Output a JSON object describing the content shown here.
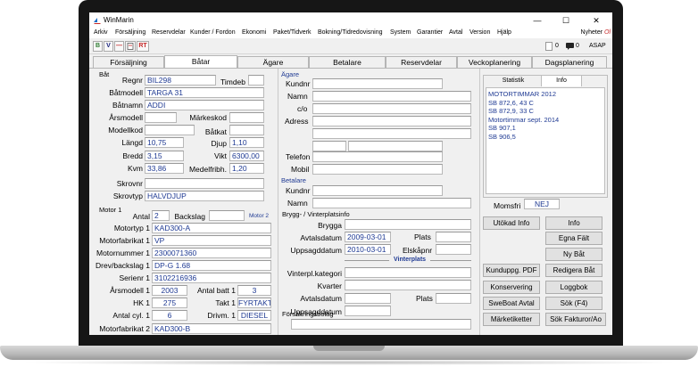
{
  "window": {
    "title": "WinMarin",
    "minimize": "—",
    "maximize": "☐",
    "close": "✕"
  },
  "menu": {
    "items": [
      "Arkiv",
      "Försäljning",
      "Reservdelar",
      "Kunder / Fordon",
      "Ekonomi",
      "Paket/Tidverk",
      "Bokning/Tidredovisning",
      "System",
      "Garantier",
      "Avtal",
      "Version",
      "Hjälp"
    ],
    "news_label": "Nyheter",
    "news_suffix": "Ol"
  },
  "toolbar": {
    "buttons": [
      "B",
      "V",
      "—",
      "",
      ""
    ],
    "rt_label": "RT",
    "counter1": "0",
    "counter2": "0",
    "asap_label": "ASAP"
  },
  "tabs": [
    "Försäljning",
    "Båtar",
    "Ägare",
    "Betalare",
    "Reservdelar",
    "Veckoplanering",
    "Dagsplanering"
  ],
  "bat": {
    "group": "Båt",
    "regnr_label": "Regnr",
    "regnr": "BIL298",
    "timdeb_label": "Timdeb",
    "timdeb": "",
    "batmodell_label": "Båtmodell",
    "batmodell": "TARGA 31",
    "batnamn_label": "Båtnamn",
    "batnamn": "ADDI",
    "arsmodell_label": "Årsmodell",
    "arsmodell": "",
    "markeskod_label": "Märkeskod",
    "markeskod": "",
    "modellkod_label": "Modellkod",
    "modellkod": "",
    "batkat_label": "Båtkat",
    "batkat": "",
    "langd_label": "Längd",
    "langd": "10,75",
    "djup_label": "Djup",
    "djup": "1,10",
    "bredd_label": "Bredd",
    "bredd": "3,15",
    "vikt_label": "Vikt",
    "vikt": "6300,00",
    "kvm_label": "Kvm",
    "kvm": "33,86",
    "medelfribh_label": "Medelfribh.",
    "medelfribh": "1,20",
    "skrovnr_label": "Skrovnr",
    "skrovnr": "",
    "skrovtyp_label": "Skrovtyp",
    "skrovtyp": "HALVDJUP"
  },
  "motor": {
    "group": "Motor 1",
    "antal_label": "Antal",
    "antal": "2",
    "backslag_label": "Backslag",
    "backslag": "",
    "motor2_label": "Motor 2",
    "motortyp_label": "Motortyp 1",
    "motortyp": "KAD300-A",
    "motorfabrikat_label": "Motorfabrikat 1",
    "motorfabrikat": "VP",
    "motornummer_label": "Motornummer 1",
    "motornummer": "2300071360",
    "drev_label": "Drev/backslag 1",
    "drev": "DP-G 1.68",
    "serienr_label": "Serienr 1",
    "serienr": "3102216936",
    "arsmodell_label": "Årsmodell 1",
    "arsmodell": "2003",
    "antal_batt_label": "Antal batt 1",
    "antal_batt": "3",
    "hk_label": "HK 1",
    "hk": "275",
    "takt_label": "Takt 1",
    "takt": "FYRTAKT",
    "antal_cyl_label": "Antal cyl. 1",
    "antal_cyl": "6",
    "drivm_label": "Drivm. 1",
    "drivm": "DIESEL",
    "bottom_label": "Motorfabrikat 2",
    "bottom_value": "KAD300-B"
  },
  "agare": {
    "group": "Ägare",
    "kundnr_label": "Kundnr",
    "kundnr": "",
    "namn_label": "Namn",
    "namn": "",
    "co_label": "c/o",
    "co": "",
    "adress_label": "Adress",
    "adress": "",
    "telefon_label": "Telefon",
    "telefon": "",
    "mobil_label": "Mobil",
    "mobil": ""
  },
  "betalare": {
    "group": "Betalare",
    "kundnr_label": "Kundnr",
    "kundnr": "",
    "namn_label": "Namn",
    "namn": ""
  },
  "brygg": {
    "group": "Brygg- / Vinterplatsinfo",
    "brygga_label": "Brygga",
    "brygga": "",
    "avtalsdatum_label": "Avtalsdatum",
    "avtalsdatum": "2009-03-01",
    "plats_label": "Plats",
    "plats": "",
    "uppsagddatum_label": "Uppsagddatum",
    "uppsagddatum": "2010-03-01",
    "elskapnr_label": "Elskåpnr",
    "elskapnr": "",
    "vinterplats_label": "Vinterplats",
    "vinterplats_kategori_label": "Vinterpl.kategori",
    "vinterplats_kategori": "",
    "kvarter_label": "Kvarter",
    "kvarter": "",
    "v_avtalsdatum_label": "Avtalsdatum",
    "v_avtalsdatum": "",
    "v_plats_label": "Plats",
    "v_plats": "",
    "v_uppsagddatum_label": "Uppsagddatum",
    "v_uppsagddatum": "",
    "forsakring_label": "Försäkringsbolag",
    "forsakring": ""
  },
  "info": {
    "tab_statistik": "Statistik",
    "tab_info": "Info",
    "lines": [
      "MOTORTIMMAR 2012",
      "SB 872,6, 43 C",
      "SB 872,9, 33 C",
      "Motortimmar sept. 2014",
      "SB 907,1",
      "SB 906,5"
    ],
    "momsfri_label": "Momsfri",
    "momsfri": "NEJ"
  },
  "buttons": {
    "utokad_info": "Utökad Info",
    "info": "Info",
    "egna_falt": "Egna Fält",
    "ny_bat": "Ny Båt",
    "kunduppg_pdf": "Kunduppg. PDF",
    "redigera_bat": "Redigera Båt",
    "konservering": "Konservering",
    "loggbok": "Loggbok",
    "sweboat_avtal": "SweBoat Avtal",
    "sok_f4": "Sök (F4)",
    "marketiketter": "Märketiketter",
    "sok_fakturor": "Sök Fakturor/Ao"
  }
}
